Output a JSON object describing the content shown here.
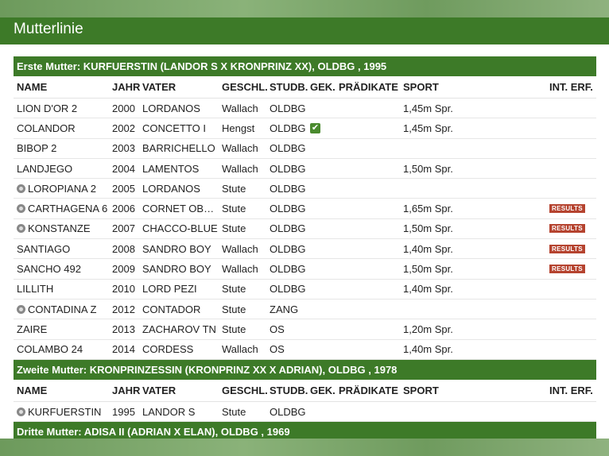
{
  "page": {
    "title": "Mutterlinie"
  },
  "columns": {
    "name": "NAME",
    "year": "JAHR",
    "sire": "VATER",
    "sex": "GESCHL.",
    "studbook": "STUDB.",
    "licensed": "GEK.",
    "predicates": "PRÄDIKATE",
    "sport": "SPORT",
    "int_results": "INT. ERF."
  },
  "sections": [
    {
      "title": "Erste Mutter: KURFUERSTIN (LANDOR S X KRONPRINZ XX), OLDBG , 1995",
      "rows": [
        {
          "name": "LION D'OR 2",
          "mare_icon": false,
          "year": "2000",
          "sire": "LORDANOS",
          "sex": "Wallach",
          "studbook": "OLDBG",
          "licensed": false,
          "sport": "1,45m Spr.",
          "results": ""
        },
        {
          "name": "COLANDOR",
          "mare_icon": false,
          "year": "2002",
          "sire": "CONCETTO I",
          "sex": "Hengst",
          "studbook": "OLDBG",
          "licensed": true,
          "sport": "1,45m Spr.",
          "results": ""
        },
        {
          "name": "BIBOP 2",
          "mare_icon": false,
          "year": "2003",
          "sire": "BARRICHELLO",
          "sex": "Wallach",
          "studbook": "OLDBG",
          "licensed": false,
          "sport": "",
          "results": ""
        },
        {
          "name": "LANDJEGO",
          "mare_icon": false,
          "year": "2004",
          "sire": "LAMENTOS",
          "sex": "Wallach",
          "studbook": "OLDBG",
          "licensed": false,
          "sport": "1,50m Spr.",
          "results": ""
        },
        {
          "name": "LOROPIANA 2",
          "mare_icon": true,
          "year": "2005",
          "sire": "LORDANOS",
          "sex": "Stute",
          "studbook": "OLDBG",
          "licensed": false,
          "sport": "",
          "results": ""
        },
        {
          "name": "CARTHAGENA 6",
          "mare_icon": true,
          "year": "2006",
          "sire": "CORNET OBO...",
          "sex": "Stute",
          "studbook": "OLDBG",
          "licensed": false,
          "sport": "1,65m Spr.",
          "results": "RESULTS"
        },
        {
          "name": "KONSTANZE",
          "mare_icon": true,
          "year": "2007",
          "sire": "CHACCO-BLUE",
          "sex": "Stute",
          "studbook": "OLDBG",
          "licensed": false,
          "sport": "1,50m Spr.",
          "results": "RESULTS"
        },
        {
          "name": "SANTIAGO",
          "mare_icon": false,
          "year": "2008",
          "sire": "SANDRO BOY",
          "sex": "Wallach",
          "studbook": "OLDBG",
          "licensed": false,
          "sport": "1,40m Spr.",
          "results": "RESULTS"
        },
        {
          "name": "SANCHO 492",
          "mare_icon": false,
          "year": "2009",
          "sire": "SANDRO BOY",
          "sex": "Wallach",
          "studbook": "OLDBG",
          "licensed": false,
          "sport": "1,50m Spr.",
          "results": "RESULTS"
        },
        {
          "name": "LILLITH",
          "mare_icon": false,
          "year": "2010",
          "sire": "LORD PEZI",
          "sex": "Stute",
          "studbook": "OLDBG",
          "licensed": false,
          "sport": "1,40m Spr.",
          "results": ""
        },
        {
          "name": "CONTADINA Z",
          "mare_icon": true,
          "year": "2012",
          "sire": "CONTADOR",
          "sex": "Stute",
          "studbook": "ZANG",
          "licensed": false,
          "sport": "",
          "results": ""
        },
        {
          "name": "ZAIRE",
          "mare_icon": false,
          "year": "2013",
          "sire": "ZACHAROV TN",
          "sex": "Stute",
          "studbook": "OS",
          "licensed": false,
          "sport": "1,20m Spr.",
          "results": ""
        },
        {
          "name": "COLAMBO 24",
          "mare_icon": false,
          "year": "2014",
          "sire": "CORDESS",
          "sex": "Wallach",
          "studbook": "OS",
          "licensed": false,
          "sport": "1,40m Spr.",
          "results": ""
        }
      ]
    },
    {
      "title": "Zweite Mutter: KRONPRINZESSIN (KRONPRINZ XX X ADRIAN), OLDBG , 1978",
      "rows": [
        {
          "name": "KURFUERSTIN",
          "mare_icon": true,
          "year": "1995",
          "sire": "LANDOR S",
          "sex": "Stute",
          "studbook": "OLDBG",
          "licensed": false,
          "sport": "",
          "results": ""
        }
      ]
    },
    {
      "title": "Dritte Mutter: ADISA II (ADRIAN X ELAN), OLDBG , 1969",
      "rows": []
    }
  ],
  "colors": {
    "green": "#3d7a28",
    "results_badge": "#b5432f",
    "check": "#4a8a2e"
  }
}
